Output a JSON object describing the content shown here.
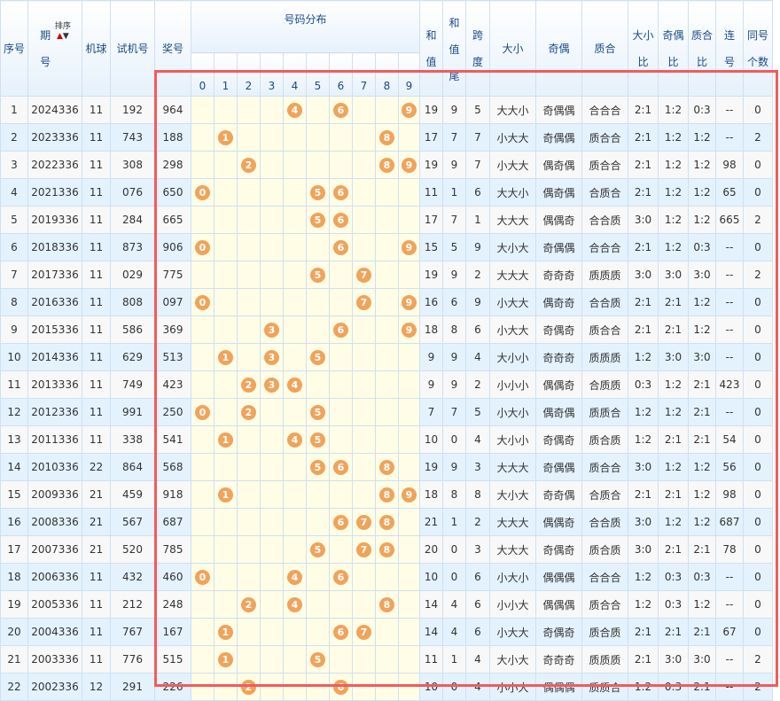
{
  "headers": {
    "seq": "序号",
    "issue": "期号",
    "sort": "排序",
    "sort_up": "▲",
    "sort_down": "▼",
    "machine": "机球",
    "test": "试机号",
    "prize": "奖号",
    "dist": "号码分布",
    "digits": [
      "0",
      "1",
      "2",
      "3",
      "4",
      "5",
      "6",
      "7",
      "8",
      "9"
    ],
    "sum": "和值",
    "sum_tail": "和值尾",
    "span": "跨度",
    "bs": "大小",
    "oe": "奇偶",
    "pc": "质合",
    "bs_ratio": "大小比",
    "oe_ratio": "奇偶比",
    "pc_ratio": "质合比",
    "consec": "连号",
    "same": "同号个数"
  },
  "accent": "#f45b5b",
  "ball_color": "#f0a35a",
  "rows": [
    {
      "seq": "1",
      "issue": "2024336",
      "machine": "11",
      "test": "192",
      "prize": "964",
      "balls": [
        4,
        6,
        9
      ],
      "sum": "19",
      "tail": "9",
      "span": "5",
      "bs": "大大小",
      "oe": "奇偶偶",
      "pc": "合合合",
      "bsr": "2:1",
      "oer": "1:2",
      "pcr": "0:3",
      "consec": "--",
      "same": "0"
    },
    {
      "seq": "2",
      "issue": "2023336",
      "machine": "11",
      "test": "743",
      "prize": "188",
      "balls": [
        1,
        8
      ],
      "sum": "17",
      "tail": "7",
      "span": "7",
      "bs": "小大大",
      "oe": "奇偶偶",
      "pc": "质合合",
      "bsr": "2:1",
      "oer": "1:2",
      "pcr": "1:2",
      "consec": "--",
      "same": "2"
    },
    {
      "seq": "3",
      "issue": "2022336",
      "machine": "11",
      "test": "308",
      "prize": "298",
      "balls": [
        2,
        8,
        9
      ],
      "sum": "19",
      "tail": "9",
      "span": "7",
      "bs": "小大大",
      "oe": "偶奇偶",
      "pc": "质合合",
      "bsr": "2:1",
      "oer": "1:2",
      "pcr": "1:2",
      "consec": "98",
      "same": "0"
    },
    {
      "seq": "4",
      "issue": "2021336",
      "machine": "11",
      "test": "076",
      "prize": "650",
      "balls": [
        0,
        5,
        6
      ],
      "sum": "11",
      "tail": "1",
      "span": "6",
      "bs": "大大小",
      "oe": "偶奇偶",
      "pc": "合质合",
      "bsr": "2:1",
      "oer": "1:2",
      "pcr": "1:2",
      "consec": "65",
      "same": "0"
    },
    {
      "seq": "5",
      "issue": "2019336",
      "machine": "11",
      "test": "284",
      "prize": "665",
      "balls": [
        5,
        6
      ],
      "sum": "17",
      "tail": "7",
      "span": "1",
      "bs": "大大大",
      "oe": "偶偶奇",
      "pc": "合合质",
      "bsr": "3:0",
      "oer": "1:2",
      "pcr": "1:2",
      "consec": "665",
      "same": "2"
    },
    {
      "seq": "6",
      "issue": "2018336",
      "machine": "11",
      "test": "873",
      "prize": "906",
      "balls": [
        0,
        6,
        9
      ],
      "sum": "15",
      "tail": "5",
      "span": "9",
      "bs": "大小大",
      "oe": "奇偶偶",
      "pc": "合合合",
      "bsr": "2:1",
      "oer": "1:2",
      "pcr": "0:3",
      "consec": "--",
      "same": "0"
    },
    {
      "seq": "7",
      "issue": "2017336",
      "machine": "11",
      "test": "029",
      "prize": "775",
      "balls": [
        5,
        7
      ],
      "sum": "19",
      "tail": "9",
      "span": "2",
      "bs": "大大大",
      "oe": "奇奇奇",
      "pc": "质质质",
      "bsr": "3:0",
      "oer": "3:0",
      "pcr": "3:0",
      "consec": "--",
      "same": "2"
    },
    {
      "seq": "8",
      "issue": "2016336",
      "machine": "11",
      "test": "808",
      "prize": "097",
      "balls": [
        0,
        7,
        9
      ],
      "sum": "16",
      "tail": "6",
      "span": "9",
      "bs": "小大大",
      "oe": "偶奇奇",
      "pc": "合合质",
      "bsr": "2:1",
      "oer": "2:1",
      "pcr": "1:2",
      "consec": "--",
      "same": "0"
    },
    {
      "seq": "9",
      "issue": "2015336",
      "machine": "11",
      "test": "586",
      "prize": "369",
      "balls": [
        3,
        6,
        9
      ],
      "sum": "18",
      "tail": "8",
      "span": "6",
      "bs": "小大大",
      "oe": "奇偶奇",
      "pc": "质合合",
      "bsr": "2:1",
      "oer": "2:1",
      "pcr": "1:2",
      "consec": "--",
      "same": "0"
    },
    {
      "seq": "10",
      "issue": "2014336",
      "machine": "11",
      "test": "629",
      "prize": "513",
      "balls": [
        1,
        3,
        5
      ],
      "sum": "9",
      "tail": "9",
      "span": "4",
      "bs": "大小小",
      "oe": "奇奇奇",
      "pc": "质质质",
      "bsr": "1:2",
      "oer": "3:0",
      "pcr": "3:0",
      "consec": "--",
      "same": "0"
    },
    {
      "seq": "11",
      "issue": "2013336",
      "machine": "11",
      "test": "749",
      "prize": "423",
      "balls": [
        2,
        3,
        4
      ],
      "sum": "9",
      "tail": "9",
      "span": "2",
      "bs": "小小小",
      "oe": "偶偶奇",
      "pc": "合质质",
      "bsr": "0:3",
      "oer": "1:2",
      "pcr": "2:1",
      "consec": "423",
      "same": "0"
    },
    {
      "seq": "12",
      "issue": "2012336",
      "machine": "11",
      "test": "991",
      "prize": "250",
      "balls": [
        0,
        2,
        5
      ],
      "sum": "7",
      "tail": "7",
      "span": "5",
      "bs": "小大小",
      "oe": "偶奇偶",
      "pc": "质质合",
      "bsr": "1:2",
      "oer": "1:2",
      "pcr": "2:1",
      "consec": "--",
      "same": "0"
    },
    {
      "seq": "13",
      "issue": "2011336",
      "machine": "11",
      "test": "338",
      "prize": "541",
      "balls": [
        1,
        4,
        5
      ],
      "sum": "10",
      "tail": "0",
      "span": "4",
      "bs": "大小小",
      "oe": "奇偶奇",
      "pc": "质合质",
      "bsr": "1:2",
      "oer": "2:1",
      "pcr": "2:1",
      "consec": "54",
      "same": "0"
    },
    {
      "seq": "14",
      "issue": "2010336",
      "machine": "22",
      "test": "864",
      "prize": "568",
      "balls": [
        5,
        6,
        8
      ],
      "sum": "19",
      "tail": "9",
      "span": "3",
      "bs": "大大大",
      "oe": "奇偶偶",
      "pc": "质合合",
      "bsr": "3:0",
      "oer": "1:2",
      "pcr": "1:2",
      "consec": "56",
      "same": "0"
    },
    {
      "seq": "15",
      "issue": "2009336",
      "machine": "21",
      "test": "459",
      "prize": "918",
      "balls": [
        1,
        8,
        9
      ],
      "sum": "18",
      "tail": "8",
      "span": "8",
      "bs": "大小大",
      "oe": "奇奇偶",
      "pc": "合质合",
      "bsr": "2:1",
      "oer": "2:1",
      "pcr": "1:2",
      "consec": "98",
      "same": "0"
    },
    {
      "seq": "16",
      "issue": "2008336",
      "machine": "21",
      "test": "567",
      "prize": "687",
      "balls": [
        6,
        7,
        8
      ],
      "sum": "21",
      "tail": "1",
      "span": "2",
      "bs": "大大大",
      "oe": "偶偶奇",
      "pc": "合合质",
      "bsr": "3:0",
      "oer": "1:2",
      "pcr": "1:2",
      "consec": "687",
      "same": "0"
    },
    {
      "seq": "17",
      "issue": "2007336",
      "machine": "21",
      "test": "520",
      "prize": "785",
      "balls": [
        5,
        7,
        8
      ],
      "sum": "20",
      "tail": "0",
      "span": "3",
      "bs": "大大大",
      "oe": "奇偶奇",
      "pc": "质合质",
      "bsr": "3:0",
      "oer": "2:1",
      "pcr": "2:1",
      "consec": "78",
      "same": "0"
    },
    {
      "seq": "18",
      "issue": "2006336",
      "machine": "11",
      "test": "432",
      "prize": "460",
      "balls": [
        0,
        4,
        6
      ],
      "sum": "10",
      "tail": "0",
      "span": "6",
      "bs": "小大小",
      "oe": "偶偶偶",
      "pc": "合合合",
      "bsr": "1:2",
      "oer": "0:3",
      "pcr": "0:3",
      "consec": "--",
      "same": "0"
    },
    {
      "seq": "19",
      "issue": "2005336",
      "machine": "11",
      "test": "212",
      "prize": "248",
      "balls": [
        2,
        4,
        8
      ],
      "sum": "14",
      "tail": "4",
      "span": "6",
      "bs": "小小大",
      "oe": "偶偶偶",
      "pc": "质合合",
      "bsr": "1:2",
      "oer": "0:3",
      "pcr": "1:2",
      "consec": "--",
      "same": "0"
    },
    {
      "seq": "20",
      "issue": "2004336",
      "machine": "11",
      "test": "767",
      "prize": "167",
      "balls": [
        1,
        6,
        7
      ],
      "sum": "14",
      "tail": "4",
      "span": "6",
      "bs": "小大大",
      "oe": "奇偶奇",
      "pc": "质合质",
      "bsr": "2:1",
      "oer": "2:1",
      "pcr": "2:1",
      "consec": "67",
      "same": "0"
    },
    {
      "seq": "21",
      "issue": "2003336",
      "machine": "11",
      "test": "776",
      "prize": "515",
      "balls": [
        1,
        5
      ],
      "sum": "11",
      "tail": "1",
      "span": "4",
      "bs": "大小大",
      "oe": "奇奇奇",
      "pc": "质质质",
      "bsr": "2:1",
      "oer": "3:0",
      "pcr": "3:0",
      "consec": "--",
      "same": "2"
    },
    {
      "seq": "22",
      "issue": "2002336",
      "machine": "12",
      "test": "291",
      "prize": "226",
      "balls": [
        2,
        6
      ],
      "sum": "10",
      "tail": "0",
      "span": "4",
      "bs": "小小大",
      "oe": "偶偶偶",
      "pc": "质质合",
      "bsr": "1:2",
      "oer": "0:3",
      "pcr": "2:1",
      "consec": "--",
      "same": "2"
    }
  ]
}
